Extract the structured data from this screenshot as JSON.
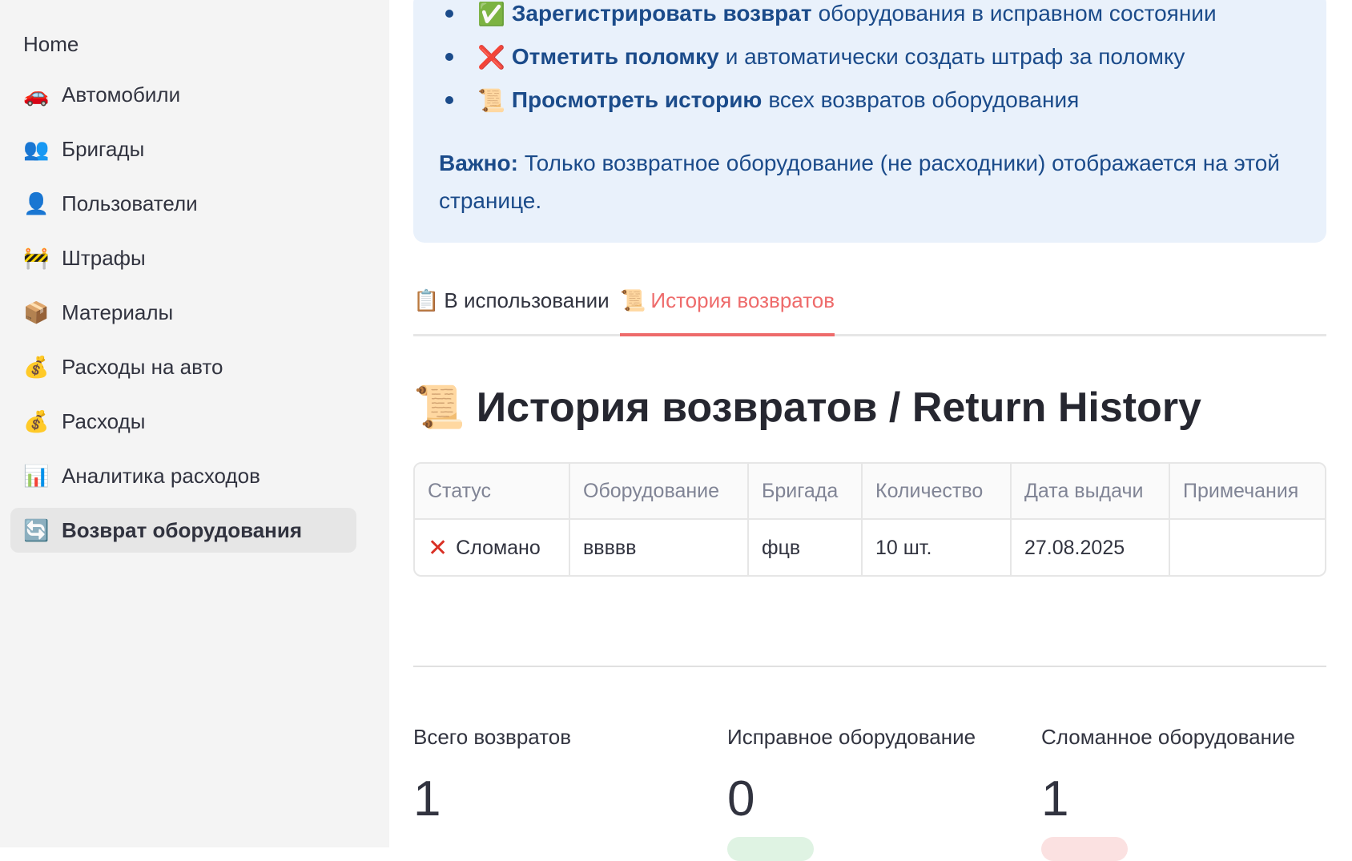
{
  "sidebar": {
    "home": "Home",
    "items": [
      {
        "icon": "🚗",
        "icon_name": "car-icon",
        "label": "Автомобили"
      },
      {
        "icon": "👥",
        "icon_name": "people-icon",
        "label": "Бригады"
      },
      {
        "icon": "👤",
        "icon_name": "person-icon",
        "label": "Пользователи"
      },
      {
        "icon": "🚧",
        "icon_name": "barrier-icon",
        "label": "Штрафы"
      },
      {
        "icon": "📦",
        "icon_name": "box-icon",
        "label": "Материалы"
      },
      {
        "icon": "💰",
        "icon_name": "money-bag-icon",
        "label": "Расходы на авто"
      },
      {
        "icon": "💰",
        "icon_name": "money-bag-icon",
        "label": "Расходы"
      },
      {
        "icon": "📊",
        "icon_name": "bar-chart-icon",
        "label": "Аналитика расходов"
      },
      {
        "icon": "🔄",
        "icon_name": "refresh-icon",
        "label": "Возврат оборудования"
      }
    ]
  },
  "info": {
    "items": [
      {
        "icon": "✅",
        "bold": "Зарегистрировать возврат",
        "text": "оборудования в исправном состоянии"
      },
      {
        "icon": "❌",
        "bold": "Отметить поломку",
        "text": "и автоматически создать штраф за поломку"
      },
      {
        "icon": "📜",
        "bold": "Просмотреть историю",
        "text": "всех возвратов оборудования"
      }
    ],
    "important_label": "Важно:",
    "important_text": "Только возвратное оборудование (не расходники) отображается на этой странице."
  },
  "tabs": [
    {
      "icon": "📋",
      "label": "В использовании"
    },
    {
      "icon": "📜",
      "label": "История возвратов"
    }
  ],
  "heading": {
    "icon": "📜",
    "text": "История возвратов / Return History"
  },
  "table": {
    "columns": [
      "Статус",
      "Оборудование",
      "Бригада",
      "Количество",
      "Дата выдачи",
      "Примечания"
    ],
    "rows": [
      {
        "status_icon": "✕",
        "status": "Сломано",
        "equipment": "ввввв",
        "brigade": "фцв",
        "quantity": "10 шт.",
        "date": "27.08.2025",
        "notes": ""
      }
    ]
  },
  "metrics": [
    {
      "label": "Всего возвратов",
      "value": "1"
    },
    {
      "label": "Исправное оборудование",
      "value": "0"
    },
    {
      "label": "Сломанное оборудование",
      "value": "1"
    }
  ],
  "colors": {
    "accent": "#ee6b6b",
    "info_text": "#1b4b8a",
    "info_bg": "#e9f1fb",
    "broken": "#d93025"
  }
}
